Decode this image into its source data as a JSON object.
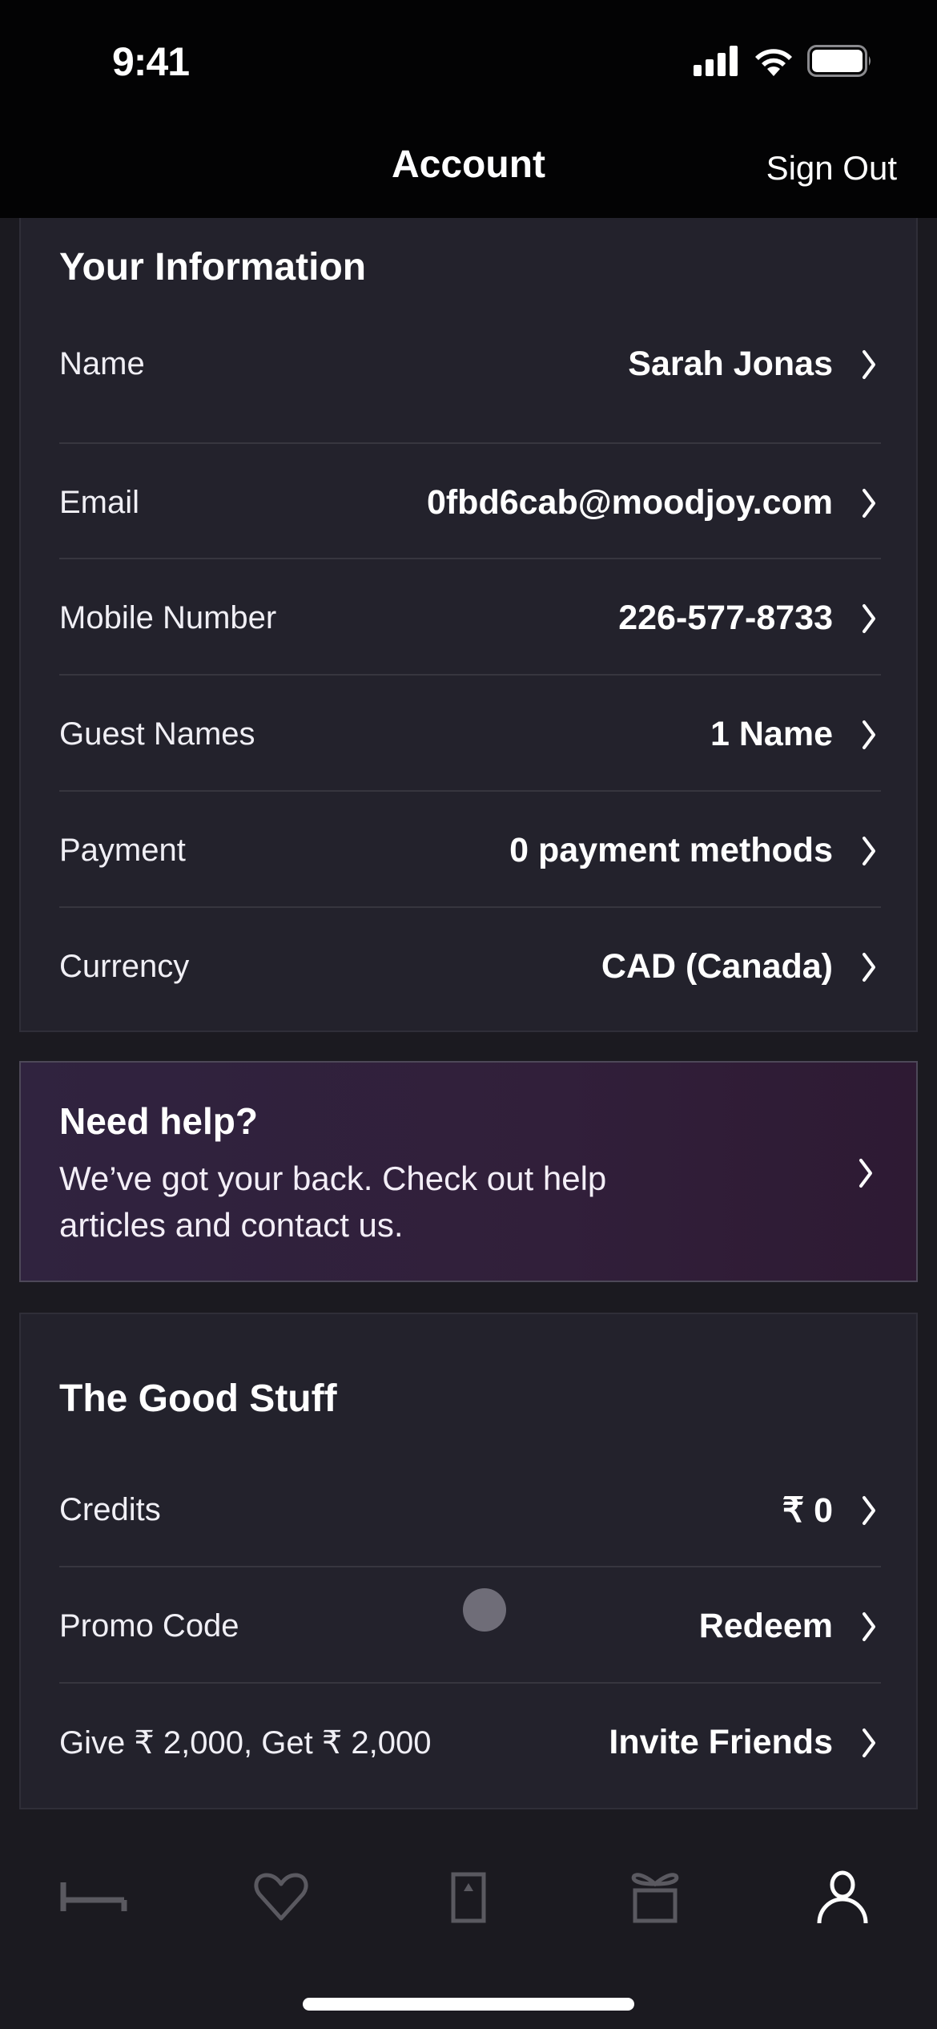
{
  "status_bar": {
    "time": "9:41"
  },
  "nav": {
    "title": "Account",
    "sign_out": "Sign Out"
  },
  "your_information": {
    "title": "Your Information",
    "rows": [
      {
        "label": "Name",
        "value": "Sarah Jonas"
      },
      {
        "label": "Email",
        "value": "0fbd6cab@moodjoy.com"
      },
      {
        "label": "Mobile Number",
        "value": "226-577-8733"
      },
      {
        "label": "Guest Names",
        "value": "1 Name"
      },
      {
        "label": "Payment",
        "value": "0 payment methods"
      },
      {
        "label": "Currency",
        "value": "CAD (Canada)"
      }
    ]
  },
  "help": {
    "title": "Need help?",
    "body": "We’ve got your back. Check out help articles and contact us."
  },
  "good_stuff": {
    "title": "The Good Stuff",
    "rows": [
      {
        "label": "Credits",
        "value": "₹ 0"
      },
      {
        "label": "Promo Code",
        "value": "Redeem"
      },
      {
        "label": "Give ₹ 2,000, Get ₹ 2,000",
        "value": "Invite Friends"
      }
    ]
  },
  "tab_bar": {
    "items": [
      {
        "icon": "bed-icon",
        "active": false
      },
      {
        "icon": "heart-icon",
        "active": false
      },
      {
        "icon": "door-key-icon",
        "active": false
      },
      {
        "icon": "gift-icon",
        "active": false
      },
      {
        "icon": "person-icon",
        "active": true
      }
    ],
    "active_color": "#ffffff",
    "inactive_color": "#5a5960"
  },
  "colors": {
    "background": "#1b1a20",
    "card": "#23222c",
    "help_gradient_start": "#30233f",
    "help_gradient_end": "#2e1a33"
  }
}
